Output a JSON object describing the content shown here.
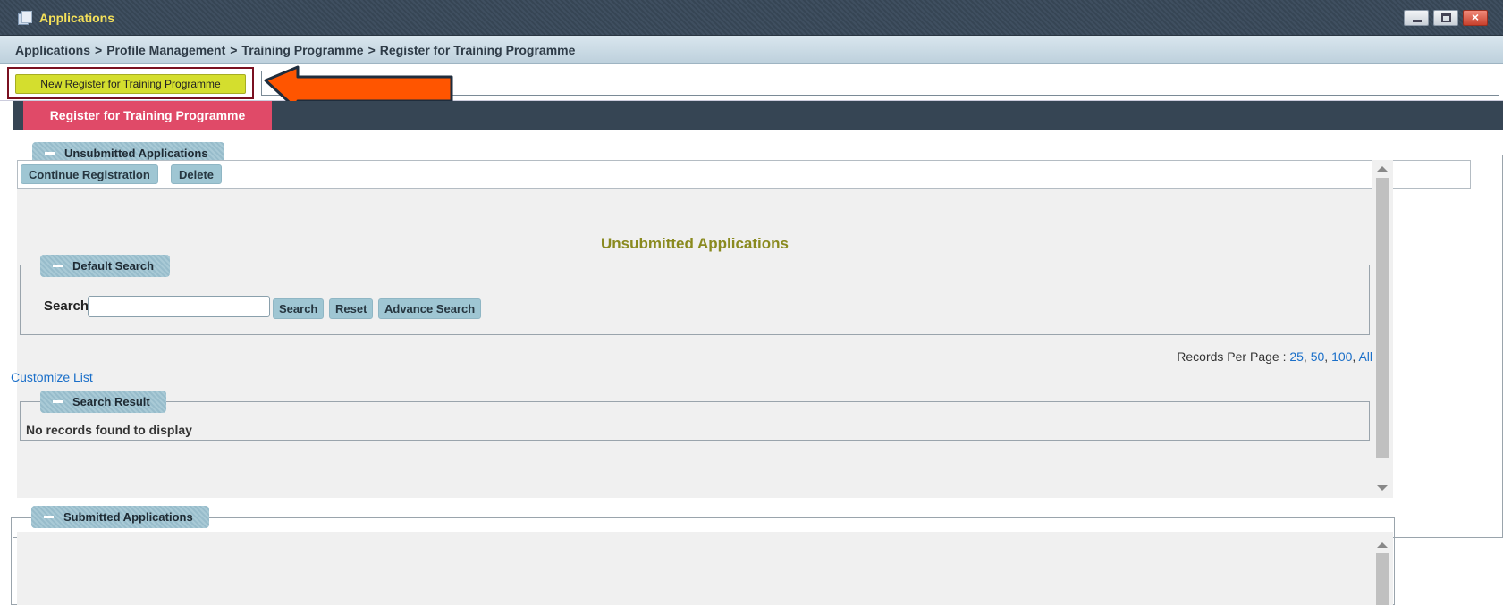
{
  "window": {
    "title": "Applications",
    "icon": "app-window-icon",
    "controls": {
      "minimize": "minimize-icon",
      "maximize": "maximize-icon",
      "close": "×"
    }
  },
  "breadcrumb": {
    "items": [
      "Applications",
      "Profile Management",
      "Training Programme",
      "Register for Training Programme"
    ],
    "separator": ">"
  },
  "toolbar": {
    "new_register_label": "New Register for Training Programme"
  },
  "tabs": [
    {
      "label": "Register for Training Programme",
      "active": true
    }
  ],
  "unsubmitted": {
    "legend": "Unsubmitted Applications",
    "continue_label": "Continue Registration",
    "delete_label": "Delete",
    "section_title": "Unsubmitted Applications",
    "default_search": {
      "legend": "Default Search",
      "search_label": "Search",
      "search_value": "",
      "search_button": "Search",
      "reset_button": "Reset",
      "advance_button": "Advance Search"
    },
    "records_per_page": {
      "label": "Records Per Page :",
      "options": [
        "25",
        "50",
        "100",
        "All"
      ]
    },
    "customize_list": "Customize List",
    "search_result": {
      "legend": "Search Result",
      "message": "No records found to display"
    }
  },
  "submitted": {
    "legend": "Submitted Applications"
  },
  "colors": {
    "titlebar": "#364554",
    "title_text": "#f5e15a",
    "accent_button": "#d4de2e",
    "active_tab": "#e04a68",
    "legend": "#a9cad6",
    "link": "#1a6fc9",
    "section_title": "#8a8a1f",
    "annotation_arrow": "#ff5500",
    "annotation_box": "#7a1020"
  }
}
